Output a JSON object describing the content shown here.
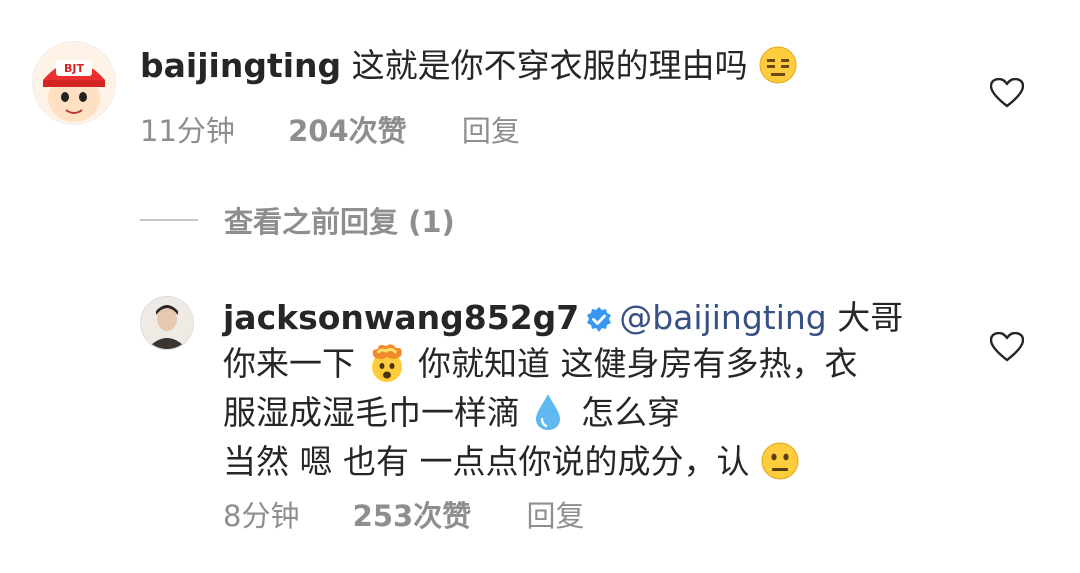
{
  "comment1": {
    "username": "baijingting",
    "text": "这就是你不穿衣服的理由吗",
    "avatar_text": "BJT",
    "emoji_icon": "expressionless-face-icon",
    "time": "11分钟",
    "likes": "204次赞",
    "reply_label": "回复"
  },
  "view_previous": {
    "label": "查看之前回复 (1)"
  },
  "reply1": {
    "username": "jacksonwang852g7",
    "mention": "@baijingting",
    "line1_after_mention": "大哥",
    "line2a": "你来一下",
    "line2b": "你就知道 这健身房有多热，衣",
    "line3a": "服湿成湿毛巾一样滴",
    "line3b": "怎么穿",
    "line4": "当然 嗯 也有 一点点你说的成分，认",
    "emoji_icons": [
      "exploding-head-icon",
      "droplet-icon",
      "neutral-face-icon"
    ],
    "verified_icon": "verified-badge-icon",
    "time": "8分钟",
    "likes": "253次赞",
    "reply_label": "回复"
  },
  "colors": {
    "text": "#262626",
    "meta": "#8e8e8e",
    "mention": "#385185",
    "verified": "#3897f0"
  }
}
